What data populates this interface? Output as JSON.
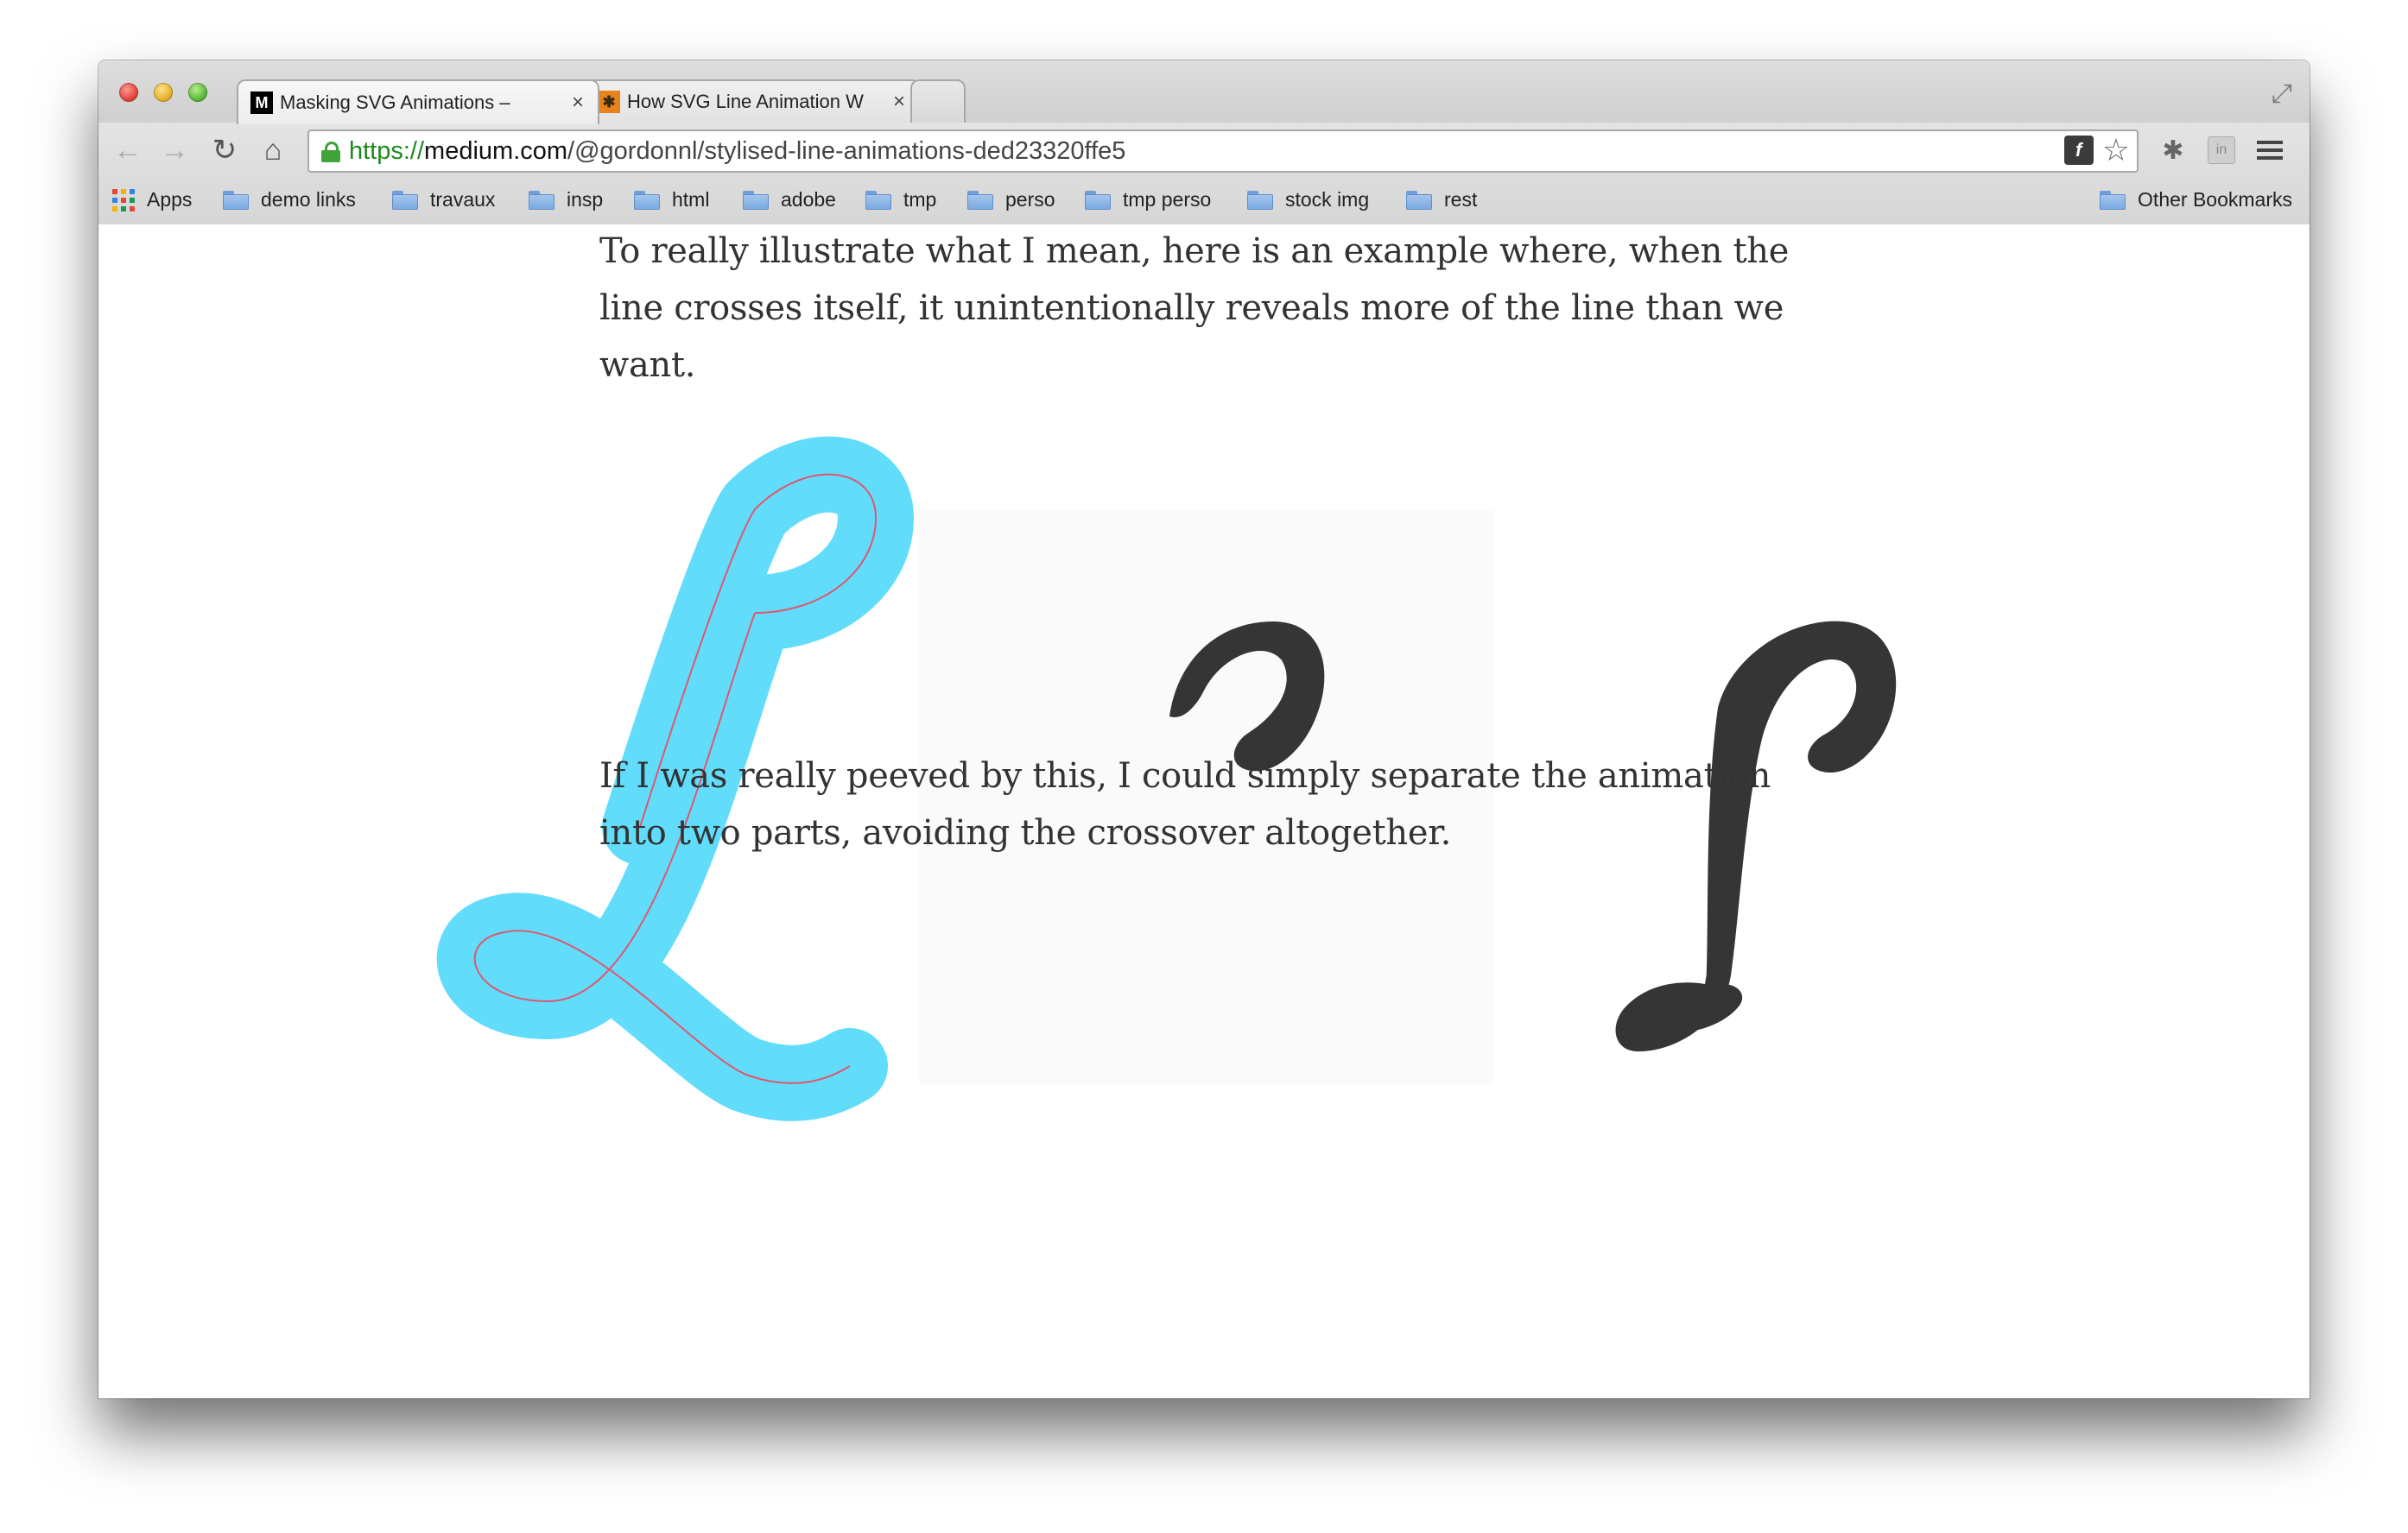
{
  "browser": {
    "tabs": [
      {
        "title": "Masking SVG Animations – ",
        "favicon": "M",
        "favicon_bg": "#000000",
        "active": true
      },
      {
        "title": "How SVG Line Animation W",
        "favicon": "✱",
        "favicon_bg": "#e8821e",
        "active": false
      }
    ],
    "close_glyph": "×",
    "url": {
      "scheme": "https",
      "separator": "://",
      "host": "medium.com",
      "path": "/@gordonnl/stylised-line-animations-ded23320ffe5"
    },
    "nav_icons": [
      "back-arrow-icon",
      "forward-arrow-icon",
      "reload-icon",
      "home-icon"
    ],
    "bookmarks": [
      {
        "label": "Apps",
        "icon": "apps-grid-icon"
      },
      {
        "label": "demo links",
        "icon": "folder-icon"
      },
      {
        "label": "travaux",
        "icon": "folder-icon"
      },
      {
        "label": "insp",
        "icon": "folder-icon"
      },
      {
        "label": "html",
        "icon": "folder-icon"
      },
      {
        "label": "adobe",
        "icon": "folder-icon"
      },
      {
        "label": "tmp",
        "icon": "folder-icon"
      },
      {
        "label": "perso",
        "icon": "folder-icon"
      },
      {
        "label": "tmp perso",
        "icon": "folder-icon"
      },
      {
        "label": "stock img",
        "icon": "folder-icon"
      },
      {
        "label": "rest",
        "icon": "folder-icon"
      }
    ],
    "other_bookmarks": "Other Bookmarks"
  },
  "article": {
    "paragraph_1": "To really illustrate what I mean, here is an example where, when the line crosses itself, it unintentionally reveals more of the line than we want.",
    "paragraph_2": "If I was really peeved by this, I could simply separate the animation into two parts, avoiding the crossover altogether."
  },
  "colors": {
    "mask_stroke": "#62dcfb",
    "path_line": "#e0566e",
    "glyph_fill": "#353535",
    "text": "#333333"
  }
}
